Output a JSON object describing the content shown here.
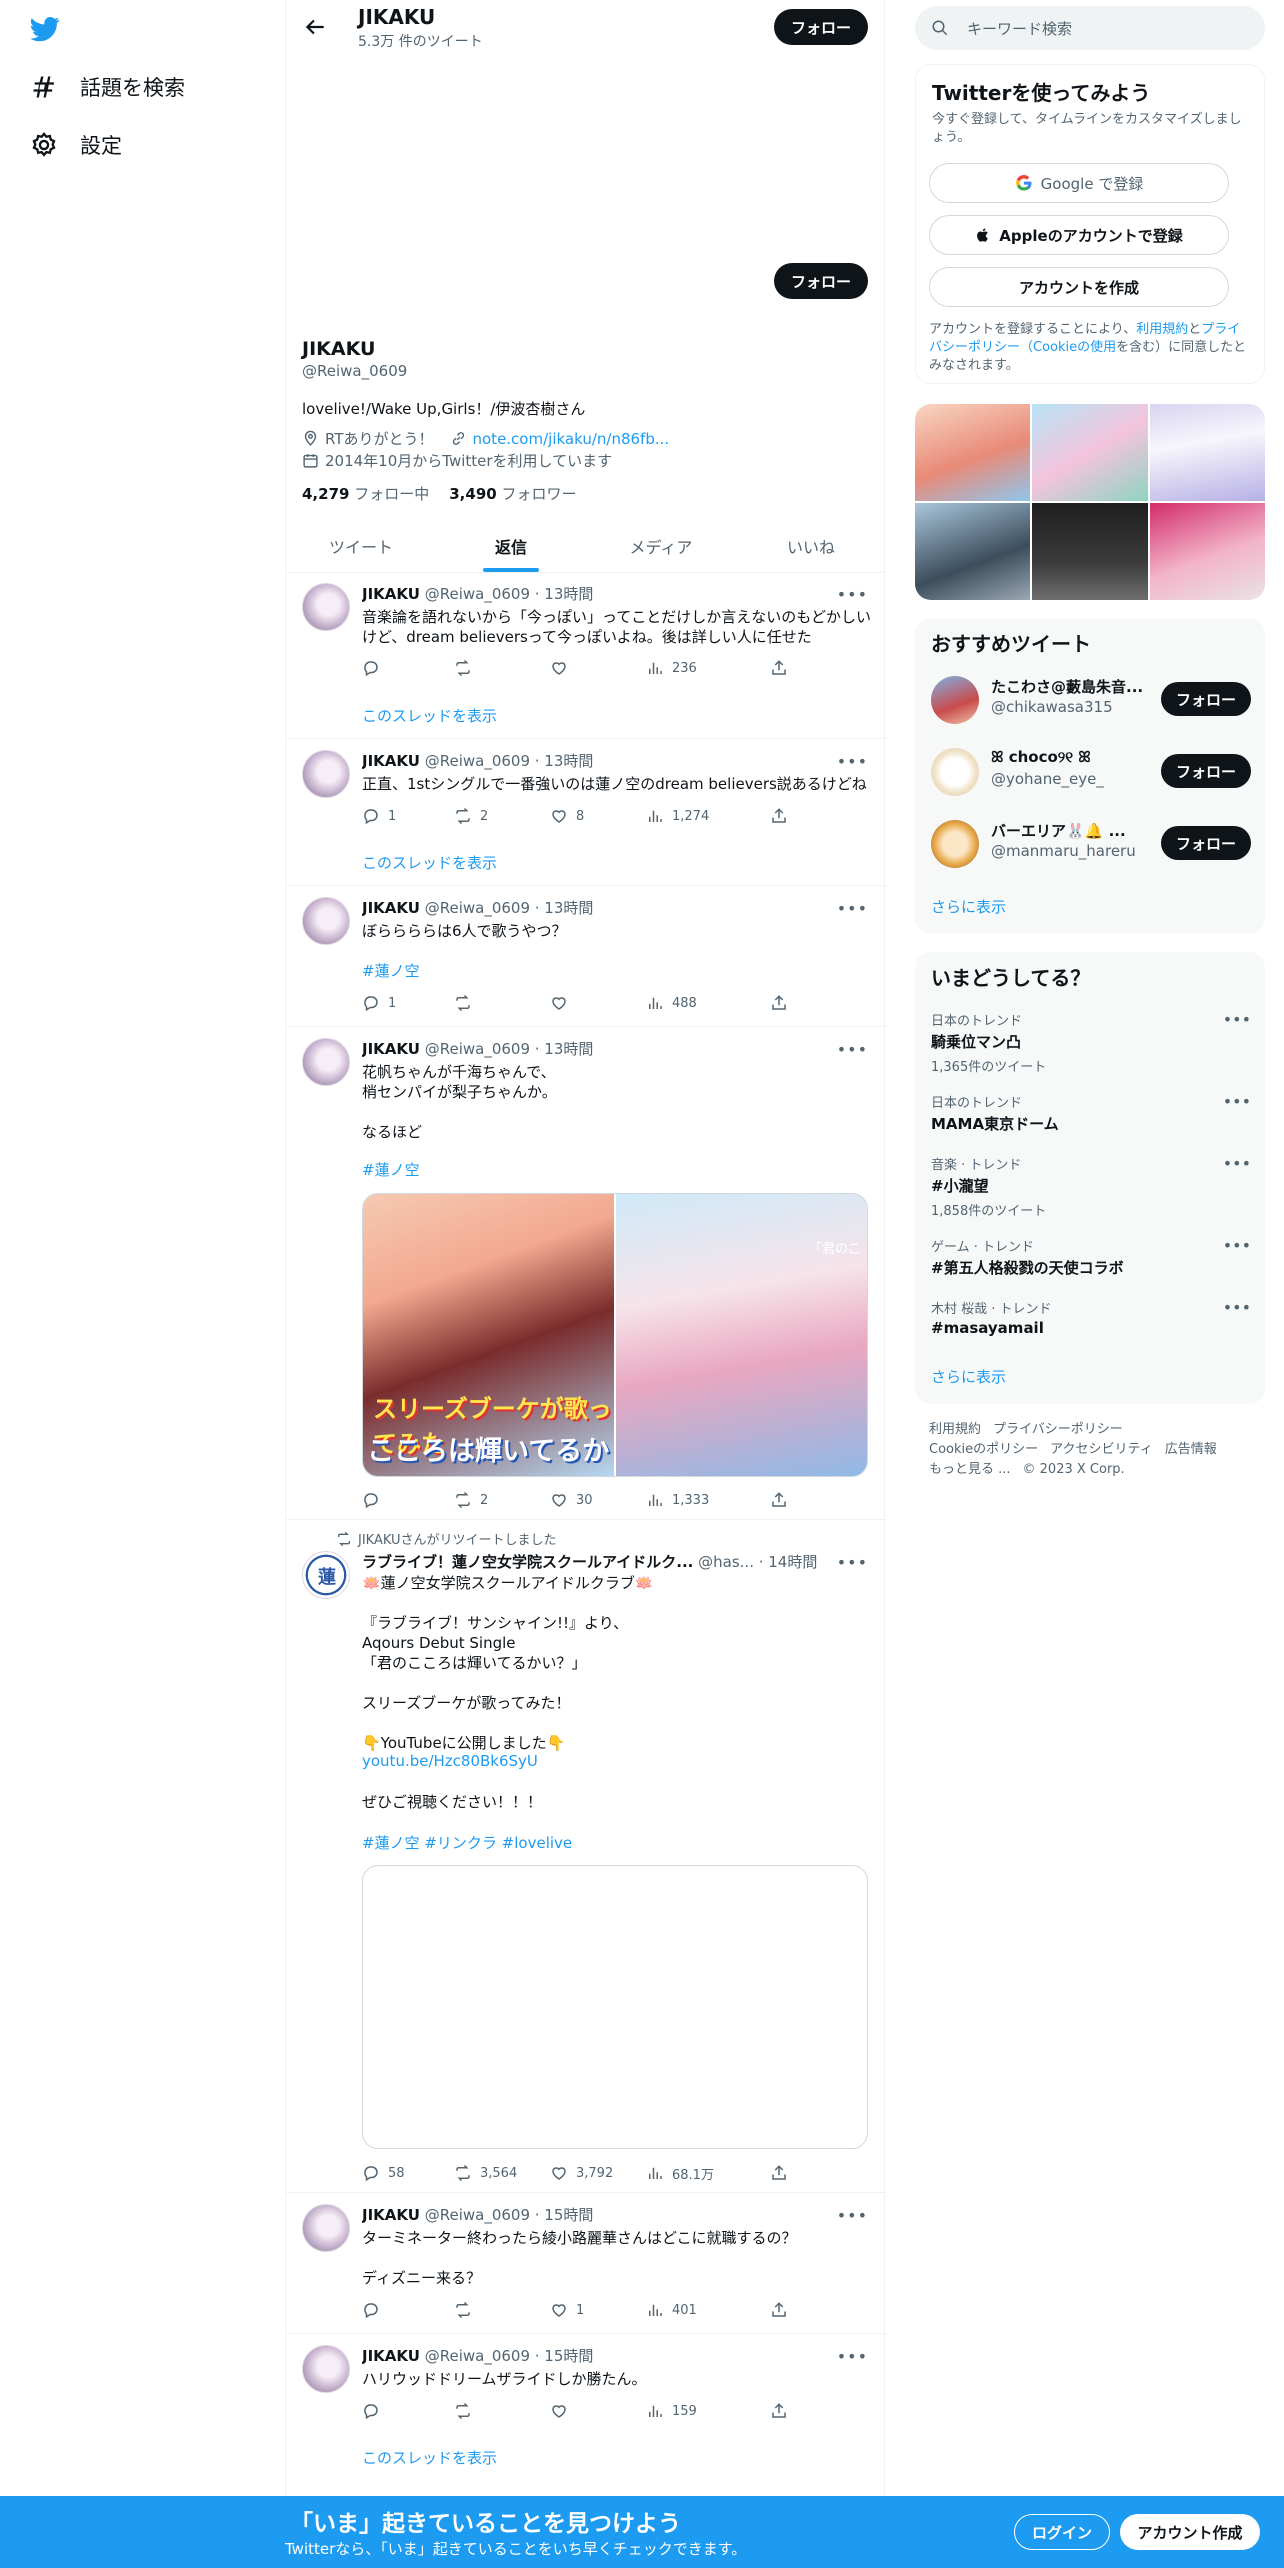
{
  "nav": {
    "explore": "話題を検索",
    "settings": "設定"
  },
  "header": {
    "name": "JIKAKU",
    "count": "5.3万 件のツイート",
    "follow": "フォロー"
  },
  "profile": {
    "follow": "フォロー",
    "name": "JIKAKU",
    "handle": "@Reiwa_0609",
    "bio": "lovelive!/Wake Up,Girls！/伊波杏樹さん",
    "location": "RTありがとう！",
    "url": "note.com/jikaku/n/n86fb...",
    "joined": "2014年10月からTwitterを利用しています",
    "following_count": "4,279",
    "following_label": "フォロー中",
    "followers_count": "3,490",
    "followers_label": "フォロワー"
  },
  "tabs": [
    "ツイート",
    "返信",
    "メディア",
    "いいね"
  ],
  "tweets": [
    {
      "name": "JIKAKU",
      "meta": "@Reiwa_0609 · 13時間",
      "text": "音楽論を語れないから「今っぽい」ってことだけしか言えないのもどかしいけど、dream believersって今っぽいよね。後は詳しい人に任せた",
      "replies": "",
      "retweets": "",
      "likes": "",
      "views": "236",
      "thread": "このスレッドを表示"
    },
    {
      "name": "JIKAKU",
      "meta": "@Reiwa_0609 · 13時間",
      "text": "正直、1stシングルで一番強いのは蓮ノ空のdream believers説あるけどね",
      "replies": "1",
      "retweets": "2",
      "likes": "8",
      "views": "1,274",
      "thread": "このスレッドを表示"
    },
    {
      "name": "JIKAKU",
      "meta": "@Reiwa_0609 · 13時間",
      "text": "ぼららららは6人で歌うやつ？",
      "hashtag": "#蓮ノ空",
      "replies": "1",
      "retweets": "",
      "likes": "",
      "views": "488"
    },
    {
      "name": "JIKAKU",
      "meta": "@Reiwa_0609 · 13時間",
      "text": "花帆ちゃんが千海ちゃんで、\n梢センパイが梨子ちゃんか。\n\nなるほど",
      "hashtag": "#蓮ノ空",
      "media_left_title": "スリーズブーケが歌ってみた",
      "media_left_caption": "こころは輝いてるか",
      "media_right_caption": "「君のこ",
      "replies": "",
      "retweets": "2",
      "likes": "30",
      "views": "1,333"
    },
    {
      "rt_label": "JIKAKUさんがリツイートしました",
      "name": "ラブライブ！蓮ノ空女学院スクールアイドルク...",
      "meta": "@has... · 14時間",
      "text": "🪷蓮ノ空女学院スクールアイドルクラブ🪷\n\n『ラブライブ！サンシャイン!!』より、\nAqours Debut Single\n「君のこころは輝いてるかい？」\n\nスリーズブーケが歌ってみた！\n\n👇YouTubeに公開しました👇",
      "link": "youtu.be/Hzc80Bk6SyU",
      "text2": "ぜひご視聴ください！！！",
      "hashtag": "#蓮ノ空 #リンクラ #lovelive",
      "replies": "58",
      "retweets": "3,564",
      "likes": "3,792",
      "views": "68.1万"
    },
    {
      "name": "JIKAKU",
      "meta": "@Reiwa_0609 · 15時間",
      "text": "ターミネーター終わったら綾小路麗華さんはどこに就職するの？\n\nディズニー来る？",
      "replies": "",
      "retweets": "",
      "likes": "1",
      "views": "401"
    },
    {
      "name": "JIKAKU",
      "meta": "@Reiwa_0609 · 15時間",
      "text": "ハリウッドドリームザライドしか勝たん。",
      "replies": "",
      "retweets": "",
      "likes": "",
      "views": "159",
      "thread": "このスレッドを表示"
    }
  ],
  "search": {
    "placeholder": "キーワード検索"
  },
  "signup": {
    "title": "Twitterを使ってみよう",
    "sub": "今すぐ登録して、タイムラインをカスタマイズしましょう。",
    "google": "Google で登録",
    "apple": "Appleのアカウントで登録",
    "create": "アカウントを作成",
    "terms_1": "アカウントを登録することにより、",
    "terms_link1": "利用規約",
    "terms_2": "と",
    "terms_link2": "プライバシーポリシー（Cookieの使用",
    "terms_3": "を含む）に同意したとみなされます。"
  },
  "recommend": {
    "title": "おすすめツイート",
    "users": [
      {
        "name": "たこわさ@藪島朱音...",
        "handle": "@chikawasa315",
        "follow": "フォロー"
      },
      {
        "name": "ꕤ choco୨୧ ꕤ",
        "handle": "@yohane_eye_",
        "follow": "フォロー"
      },
      {
        "name": "バーエリア🐰🔔 ...",
        "handle": "@manmaru_hareru",
        "follow": "フォロー"
      }
    ],
    "more": "さらに表示"
  },
  "trends": {
    "title": "いまどうしてる？",
    "items": [
      {
        "cat": "日本のトレンド",
        "name": "騎乗位マン凸",
        "count": "1,365件のツイート"
      },
      {
        "cat": "日本のトレンド",
        "name": "MAMA東京ドーム",
        "count": ""
      },
      {
        "cat": "音楽 · トレンド",
        "name": "#小瀧望",
        "count": "1,858件のツイート"
      },
      {
        "cat": "ゲーム · トレンド",
        "name": "#第五人格殺戮の天使コラボ",
        "count": ""
      },
      {
        "cat": "木村 桜哉 · トレンド",
        "name": "#masayamail",
        "count": ""
      }
    ],
    "more": "さらに表示"
  },
  "footer": {
    "terms": "利用規約",
    "privacy": "プライバシーポリシー",
    "cookie": "Cookieのポリシー",
    "access": "アクセシビリティ",
    "ads": "広告情報",
    "more": "もっと見る ...",
    "copy": "© 2023 X Corp."
  },
  "bottombar": {
    "title": "「いま」起きていることを見つけよう",
    "sub": "Twitterなら、「いま」起きていることをいち早くチェックできます。",
    "login": "ログイン",
    "register": "アカウント作成"
  },
  "colors": {
    "accent": "#1d9bf0",
    "text": "#0f1419",
    "muted": "#536471"
  }
}
